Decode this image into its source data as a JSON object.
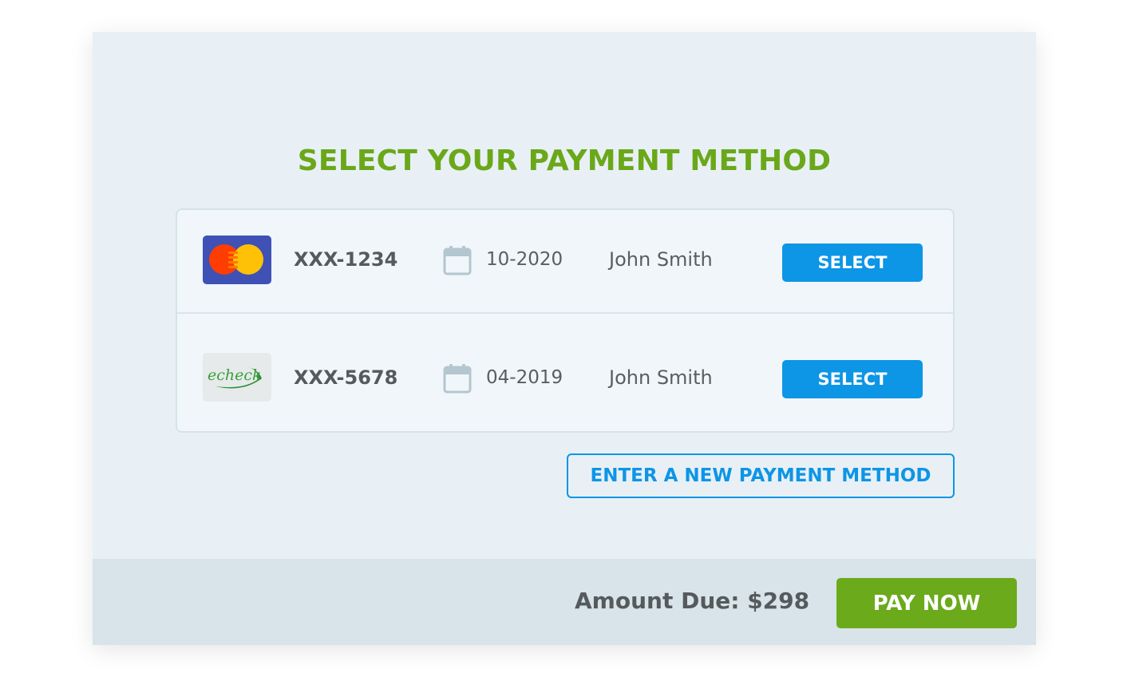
{
  "title": "SELECT YOUR PAYMENT METHOD",
  "methods": [
    {
      "type": "mastercard",
      "icon": "mastercard-logo",
      "account": "XXX-1234",
      "date_icon": "calendar-icon",
      "expiry": "10-2020",
      "name": "John Smith",
      "select_label": "SELECT"
    },
    {
      "type": "echeck",
      "icon": "echeck-logo",
      "logo_text": "echeck",
      "account": "XXX-5678",
      "date_icon": "calendar-icon",
      "expiry": "04-2019",
      "name": "John Smith",
      "select_label": "SELECT"
    }
  ],
  "new_method_label": "ENTER A NEW PAYMENT METHOD",
  "footer": {
    "amount_due": "Amount Due: $298",
    "pay_label": "PAY NOW"
  },
  "colors": {
    "title": "#6aa81a",
    "primary_blue": "#0d95e6",
    "pay_green": "#6aaa1b",
    "panel_bg": "#e8f0f5",
    "footer_bg": "#d8e4e9"
  }
}
